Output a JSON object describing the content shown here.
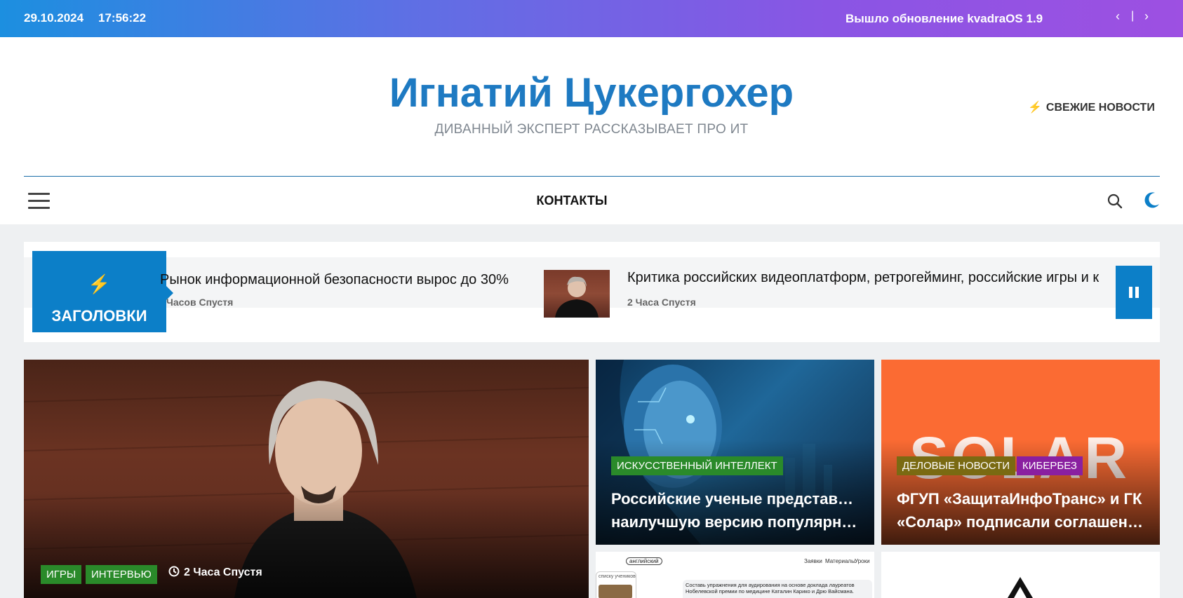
{
  "topbar": {
    "date": "29.10.2024",
    "time": "17:56:22",
    "news_text": "Вышло обновление kvadraOS 1.9",
    "prev_icon": "‹",
    "separator": "|",
    "next_icon": "›"
  },
  "header": {
    "site_title": "Игнатий Цукергохер",
    "tagline": "ДИВАННЫЙ ЭКСПЕРТ РАССКАЗЫВАЕТ ПРО ИТ",
    "fresh_news": "СВЕЖИЕ НОВОСТИ"
  },
  "nav": {
    "contacts": "КОНТАКТЫ"
  },
  "ticker": {
    "label": "ЗАГОЛОВКИ",
    "items": [
      {
        "title": "Рынок информационной безопасности вырос до 30%",
        "time": "Часов Спустя"
      },
      {
        "title": "Критика российских видеоплатформ, ретрогейминг, российские игры и к",
        "time": "2 Часа Спустя"
      }
    ]
  },
  "cards": {
    "main": {
      "tags": [
        "ИГРЫ",
        "ИНТЕРВЬЮ"
      ],
      "time": "2 Часа Спустя"
    },
    "ai": {
      "tag": "ИСКУССТВЕННЫЙ ИНТЕЛЛЕКТ",
      "title_line1": "Российские ученые представили",
      "title_line2": "наилучшую версию популярног…"
    },
    "solar": {
      "tags": [
        "ДЕЛОВЫЕ НОВОСТИ",
        "КИБЕРБЕЗ"
      ],
      "logo_text": "SOLAR",
      "title_line1": "ФГУП «ЗащитаИнфоТранс» и ГК",
      "title_line2": "«Солар» подписали соглашение…"
    },
    "english": {
      "chip": "английский",
      "menu": [
        "Заявки",
        "Материалы",
        "Уроки"
      ],
      "side_label": "списку учеников",
      "text": "Составь упражнения для аудирования на основе доклада лауреатов Нобелевской премии по медицине Каталин Карико и Дрю Вайсмана."
    }
  },
  "colors": {
    "accent": "#0c7fc8",
    "title": "#1e7ac2",
    "tag_green": "#2a8a2a",
    "tag_olive": "#7a6a12",
    "tag_purple": "#8a1fa0",
    "solar_bg": "#fb6b33"
  },
  "icons": {
    "menu": "hamburger-icon",
    "search": "search-icon",
    "dark_mode": "moon-icon",
    "ticker": "bolt-icon",
    "pause": "pause-icon",
    "clock": "clock-icon"
  }
}
